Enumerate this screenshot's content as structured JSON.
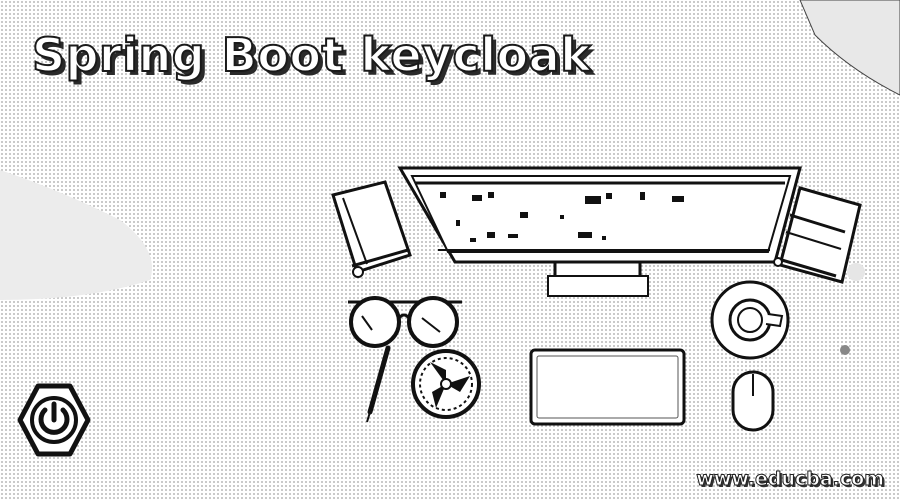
{
  "title": "Spring Boot keycloak",
  "watermark": "www.educba.com",
  "icons": {
    "logo": "spring-boot-power-icon",
    "monitor": "monitor-icon",
    "notebook": "notebook-icon",
    "books": "books-icon",
    "glasses": "glasses-icon",
    "pen": "pen-icon",
    "fan": "desk-fan-icon",
    "keyboard": "keyboard-icon",
    "coffee": "coffee-cup-icon",
    "mouse": "mouse-icon"
  },
  "colors": {
    "background": "#ffffff",
    "ink": "#1a1a1a",
    "dots": "#b8b8b8"
  }
}
